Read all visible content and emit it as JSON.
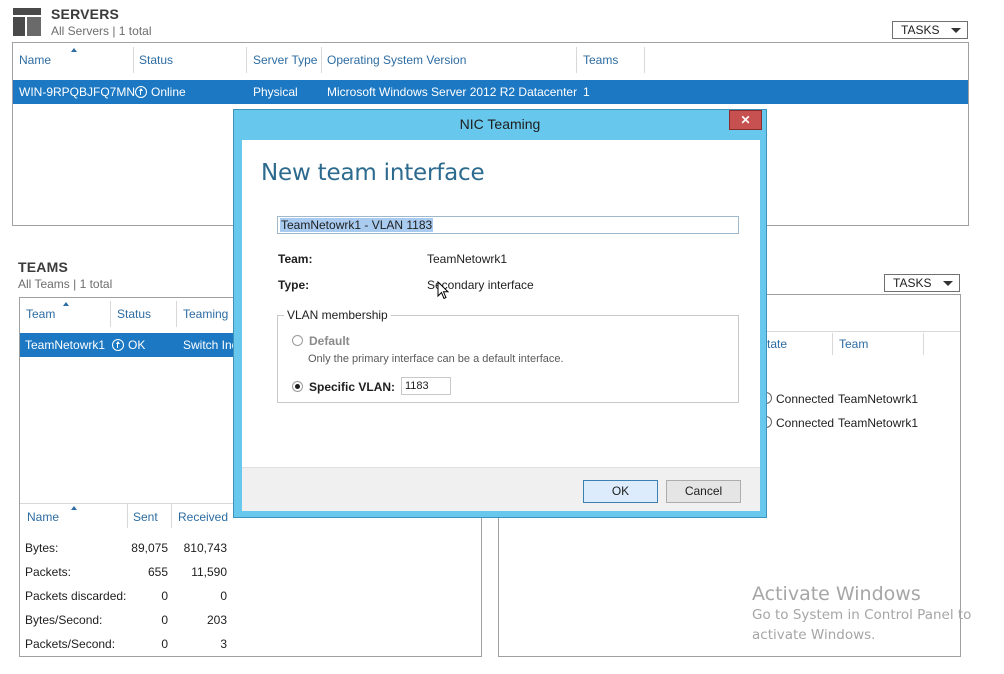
{
  "servers": {
    "title": "SERVERS",
    "subtitle": "All Servers | 1 total",
    "tasks_label": "TASKS",
    "columns": [
      "Name",
      "Status",
      "Server Type",
      "Operating System Version",
      "Teams"
    ],
    "row": {
      "name": "WIN-9RPQBJFQ7MN",
      "status": "Online",
      "server_type": "Physical",
      "os_version": "Microsoft Windows Server 2012 R2 Datacenter",
      "teams": "1"
    }
  },
  "teams": {
    "title": "TEAMS",
    "subtitle": "All Teams | 1 total",
    "tasks_label": "TASKS",
    "columns": [
      "Team",
      "Status",
      "Teaming"
    ],
    "row": {
      "team": "TeamNetowrk1",
      "status": "OK",
      "teaming": "Switch Ind"
    },
    "stats_columns": [
      "Name",
      "Sent",
      "Received"
    ],
    "stats": [
      {
        "name": "Bytes:",
        "sent": "89,075",
        "received": "810,743"
      },
      {
        "name": "Packets:",
        "sent": "655",
        "received": "11,590"
      },
      {
        "name": "Packets discarded:",
        "sent": "0",
        "received": "0"
      },
      {
        "name": "Bytes/Second:",
        "sent": "0",
        "received": "203"
      },
      {
        "name": "Packets/Second:",
        "sent": "0",
        "received": "3"
      }
    ]
  },
  "adapters": {
    "columns": [
      "tate",
      "Team"
    ],
    "rows": [
      {
        "state": "Connected",
        "team": "TeamNetowrk1"
      },
      {
        "state": "Connected",
        "team": "TeamNetowrk1"
      }
    ]
  },
  "dialog": {
    "window_title": "NIC Teaming",
    "close_glyph": "✕",
    "heading": "New team interface",
    "interface_name": "TeamNetowrk1 - VLAN 1183",
    "team_label": "Team:",
    "team_value": "TeamNetowrk1",
    "type_label": "Type:",
    "type_value": "Secondary interface",
    "vlan_group_label": "VLAN membership",
    "default_label": "Default",
    "default_note": "Only the primary interface can be a default interface.",
    "specific_label": "Specific VLAN:",
    "specific_value": "1183",
    "ok_label": "OK",
    "cancel_label": "Cancel"
  },
  "watermark": {
    "line1": "Activate Windows",
    "line2": "Go to System in Control Panel to",
    "line3": "activate Windows."
  },
  "colors": {
    "accent_blue": "#1c78c2",
    "dialog_frame": "#67c7ec",
    "close_red": "#c75050",
    "header_text_blue": "#2d6ca2"
  }
}
